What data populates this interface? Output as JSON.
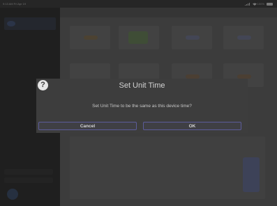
{
  "status_bar": {
    "time": "9:13 AM  Fri Apr 19",
    "battery": "100%"
  },
  "dialog": {
    "icon": "help-icon",
    "title": "Set Unit Time",
    "message": "Set Unit Time to be the same as this device time?",
    "cancel_label": "Cancel",
    "ok_label": "OK"
  },
  "colors": {
    "overlay": "#3c3c3c",
    "dialog_bg": "#3d3d3d",
    "button_border": "#5c5c9a"
  }
}
